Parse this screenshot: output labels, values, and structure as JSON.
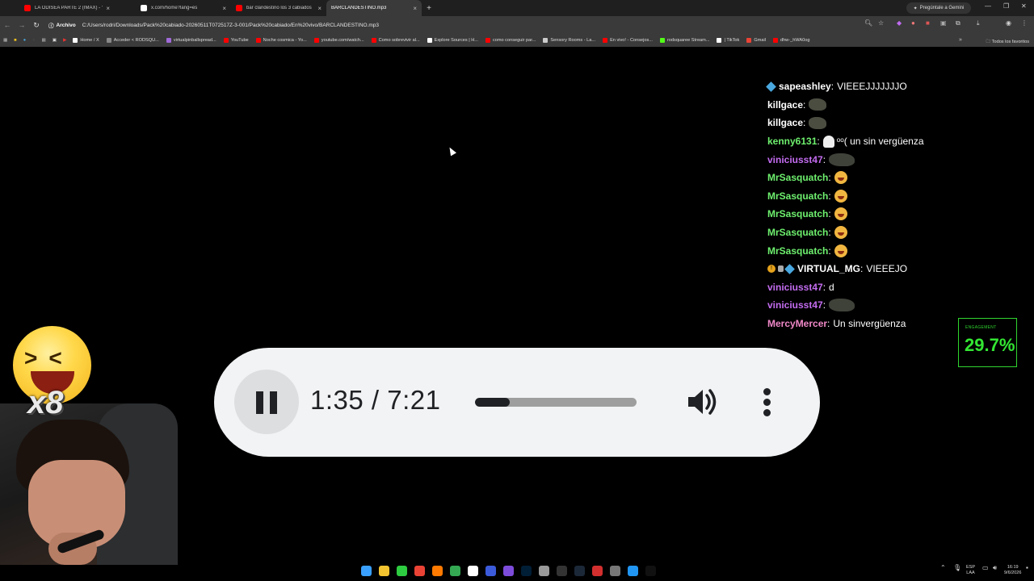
{
  "browser": {
    "tabs": [
      {
        "label": "LA ODISEA PARTE 2 (IMAX) - Yo",
        "icon": "youtube-icon",
        "color": "#ff0000",
        "active": false
      },
      {
        "label": "x.com/home?lang=es",
        "icon": "x-icon",
        "color": "#ffffff",
        "active": false
      },
      {
        "label": "bar clandestino los 3 cabiados",
        "icon": "youtube-icon",
        "color": "#ff0000",
        "active": false
      },
      {
        "label": "BARCLANDESTINO.mp3",
        "icon": "file-icon",
        "color": "#8ab4f8",
        "active": true
      }
    ],
    "gemini_label": "Pregúntale a Gemini",
    "address": {
      "chip": "Archivo",
      "url": "C:/Users/rodri/Downloads/Pack%20cabiado-20260511T072517Z-3-001/Pack%20cabiado/En%20vivo/BARCLANDESTINO.mp3"
    },
    "bookmarks": [
      {
        "label": "Home / X",
        "color": "#ffffff"
      },
      {
        "label": "Acceder < RODSQU...",
        "color": "#888888"
      },
      {
        "label": "virtualpinballspread...",
        "color": "#a06ad8"
      },
      {
        "label": "YouTube",
        "color": "#ff0000"
      },
      {
        "label": "Noche cosmica - Yo...",
        "color": "#ff0000"
      },
      {
        "label": "youtube.com/watch...",
        "color": "#ff0000"
      },
      {
        "label": "Como sobrevivir al...",
        "color": "#ff0000"
      },
      {
        "label": "Explore Sources | H...",
        "color": "#ffffff"
      },
      {
        "label": "como conseguir par...",
        "color": "#ff0000"
      },
      {
        "label": "Sensory Rooms - La...",
        "color": "#cccccc"
      },
      {
        "label": "En vivo! - Consejos...",
        "color": "#ff0000"
      },
      {
        "label": "rodsquaree Stream...",
        "color": "#53fc18"
      },
      {
        "label": "| TikTok",
        "color": "#ffffff"
      },
      {
        "label": "Gmail",
        "color": "#ea4335"
      },
      {
        "label": "dhw-_hWA0og",
        "color": "#ff0000"
      }
    ],
    "bookmarks_folder": "Todos los favoritos"
  },
  "chat": {
    "messages": [
      {
        "user": "sapeashley",
        "color": "#ffffff",
        "badge": "blue",
        "text": "VIEEEJJJJJJJO",
        "emote": ""
      },
      {
        "user": "killgace",
        "color": "#ffffff",
        "badge": "",
        "text": "",
        "emote": "rock"
      },
      {
        "user": "killgace",
        "color": "#ffffff",
        "badge": "",
        "text": "",
        "emote": "rock"
      },
      {
        "user": "kenny6131",
        "color": "#6ef06e",
        "badge": "",
        "text": "ᵒᵒ( un sin vergüenza",
        "emote": "ghost"
      },
      {
        "user": "viniciusst47",
        "color": "#c36cf0",
        "badge": "",
        "text": "",
        "emote": "rock-wide"
      },
      {
        "user": "MrSasquatch",
        "color": "#6ef06e",
        "badge": "",
        "text": "",
        "emote": "laugh"
      },
      {
        "user": "MrSasquatch",
        "color": "#6ef06e",
        "badge": "",
        "text": "",
        "emote": "laugh"
      },
      {
        "user": "MrSasquatch",
        "color": "#6ef06e",
        "badge": "",
        "text": "",
        "emote": "laugh"
      },
      {
        "user": "MrSasquatch",
        "color": "#6ef06e",
        "badge": "",
        "text": "",
        "emote": "laugh"
      },
      {
        "user": "MrSasquatch",
        "color": "#6ef06e",
        "badge": "",
        "text": "",
        "emote": "laugh"
      },
      {
        "user": "VIRTUAL_MG",
        "color": "#ffffff",
        "badge": "gold-blue",
        "text": "VIEEEJO",
        "emote": ""
      },
      {
        "user": "viniciusst47",
        "color": "#c36cf0",
        "badge": "",
        "text": "d",
        "emote": ""
      },
      {
        "user": "viniciusst47",
        "color": "#c36cf0",
        "badge": "",
        "text": "",
        "emote": "rock-wide"
      },
      {
        "user": "MercyMercer",
        "color": "#f088c8",
        "badge": "",
        "text": "Un sinvergüenza",
        "emote": ""
      }
    ]
  },
  "engagement": {
    "label": "ENGAGEMENT",
    "value": "29.7%",
    "color": "#33e633"
  },
  "player": {
    "time": "1:35 / 7:21",
    "progress_fraction": 0.215,
    "state": "playing"
  },
  "overlay": {
    "multiplier": "x8"
  },
  "taskbar": {
    "icons": [
      {
        "name": "windows-start-icon",
        "color": "#3aa0ff"
      },
      {
        "name": "file-explorer-icon",
        "color": "#f4c430"
      },
      {
        "name": "green-app-icon",
        "color": "#2ecc40"
      },
      {
        "name": "chrome-icon",
        "color": "#ea4335"
      },
      {
        "name": "search-app-icon",
        "color": "#ff7a00"
      },
      {
        "name": "chrome-alt-icon",
        "color": "#34a853"
      },
      {
        "name": "white-app-icon",
        "color": "#ffffff"
      },
      {
        "name": "v-app-icon",
        "color": "#3b5bdb"
      },
      {
        "name": "grid-app-icon",
        "color": "#7d4cdb"
      },
      {
        "name": "photoshop-icon",
        "color": "#001e36"
      },
      {
        "name": "camera-app-icon",
        "color": "#999999"
      },
      {
        "name": "obs-icon",
        "color": "#333333"
      },
      {
        "name": "steam-icon",
        "color": "#1b2838"
      },
      {
        "name": "red-app-icon",
        "color": "#d32f2f"
      },
      {
        "name": "settings-icon",
        "color": "#777777"
      },
      {
        "name": "blue-app-icon",
        "color": "#2196f3"
      },
      {
        "name": "capcut-icon",
        "color": "#111111"
      }
    ],
    "lang": "ESP",
    "lang2": "LAA",
    "time": "16:19",
    "date": "9/6/2026"
  }
}
